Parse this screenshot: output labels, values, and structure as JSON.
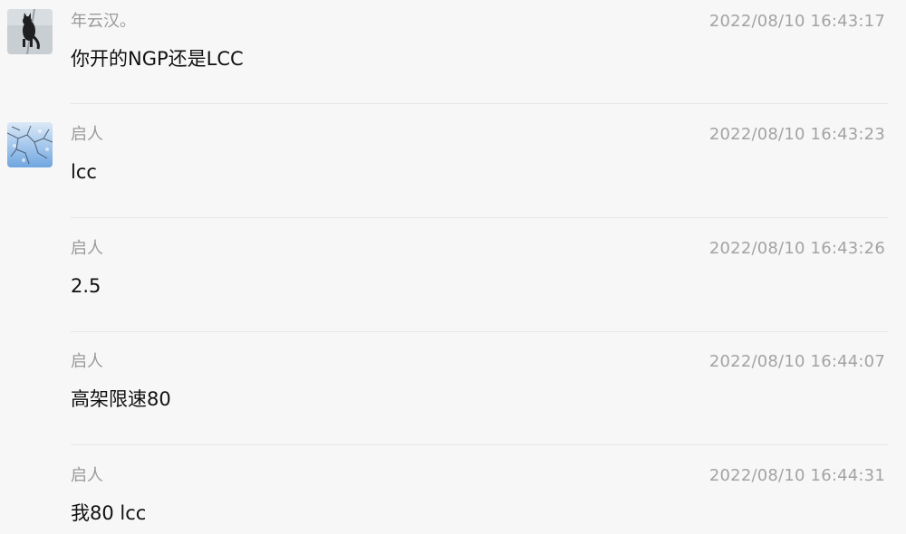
{
  "messages": [
    {
      "sender": "年云汉。",
      "time": "2022/08/10 16:43:17",
      "text": "你开的NGP还是LCC",
      "avatar": "cat-photo-avatar"
    },
    {
      "sender": "启人",
      "time": "2022/08/10 16:43:23",
      "text": "lcc",
      "avatar": "sky-branches-avatar"
    },
    {
      "sender": "启人",
      "time": "2022/08/10 16:43:26",
      "text": "2.5"
    },
    {
      "sender": "启人",
      "time": "2022/08/10 16:44:07",
      "text": "高架限速80"
    },
    {
      "sender": "启人",
      "time": "2022/08/10 16:44:31",
      "text": "我80 lcc"
    }
  ],
  "colors": {
    "background": "#f7f7f7",
    "sender": "#9a9a9a",
    "timestamp": "#a3a3a3",
    "message_text": "#111111",
    "divider": "#e6e6e6"
  }
}
